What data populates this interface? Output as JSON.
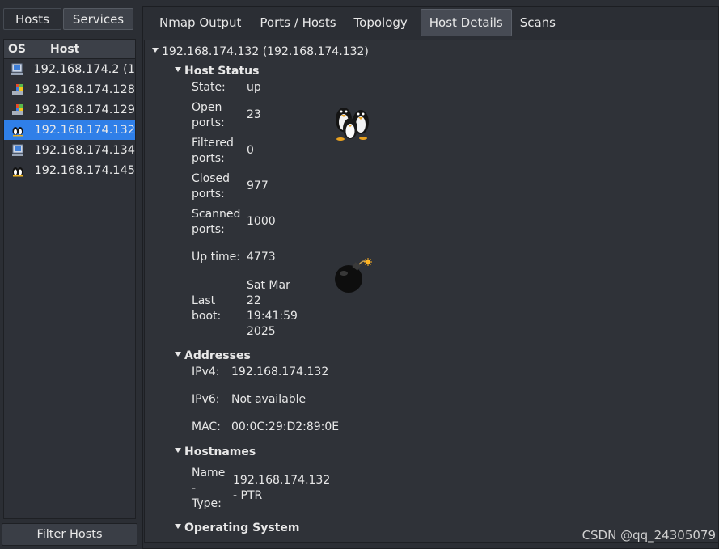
{
  "left_panel": {
    "tabs": {
      "hosts": "Hosts",
      "services": "Services"
    },
    "columns": {
      "os": "OS",
      "host": "Host"
    },
    "hosts": [
      {
        "icon": "windows-icon",
        "ip": "192.168.174.2 (1"
      },
      {
        "icon": "windows-xp-icon",
        "ip": "192.168.174.128"
      },
      {
        "icon": "windows-xp-icon",
        "ip": "192.168.174.129"
      },
      {
        "icon": "linux-penguin-icon",
        "ip": "192.168.174.132",
        "selected": true
      },
      {
        "icon": "windows-icon",
        "ip": "192.168.174.134"
      },
      {
        "icon": "linux-penguin-icon",
        "ip": "192.168.174.145"
      }
    ],
    "filter_button": "Filter Hosts"
  },
  "tabs": [
    "Nmap Output",
    "Ports / Hosts",
    "Topology",
    "Host Details",
    "Scans"
  ],
  "active_tab": "Host Details",
  "details": {
    "host_title": "192.168.174.132 (192.168.174.132)",
    "host_status": {
      "heading": "Host Status",
      "state_label": "State:",
      "state": "up",
      "open_label_1": "Open",
      "open_label_2": "ports:",
      "open": "23",
      "filtered_label_1": "Filtered",
      "filtered_label_2": "ports:",
      "filtered": "0",
      "closed_label_1": "Closed",
      "closed_label_2": "ports:",
      "closed": "977",
      "scanned_label_1": "Scanned",
      "scanned_label_2": "ports:",
      "scanned": "1000",
      "uptime_label": "Up time:",
      "uptime": "4773",
      "lastboot_label_1": "Last",
      "lastboot_label_2": "boot:",
      "lastboot_1": "Sat Mar",
      "lastboot_2": "22",
      "lastboot_3": "19:41:59",
      "lastboot_4": "2025"
    },
    "addresses": {
      "heading": "Addresses",
      "ipv4_label": "IPv4:",
      "ipv4": "192.168.174.132",
      "ipv6_label": "IPv6:",
      "ipv6": "Not available",
      "mac_label": "MAC:",
      "mac": "00:0C:29:D2:89:0E"
    },
    "hostnames": {
      "heading": "Hostnames",
      "name_label_1": "Name",
      "name_label_2": "-",
      "name_label_3": "Type:",
      "name_1": "192.168.174.132",
      "name_2": "- PTR"
    },
    "os": {
      "heading": "Operating System"
    }
  },
  "watermark": "CSDN @qq_24305079",
  "colors": {
    "selection": "#2f7fe8",
    "background": "#2b2e34"
  }
}
